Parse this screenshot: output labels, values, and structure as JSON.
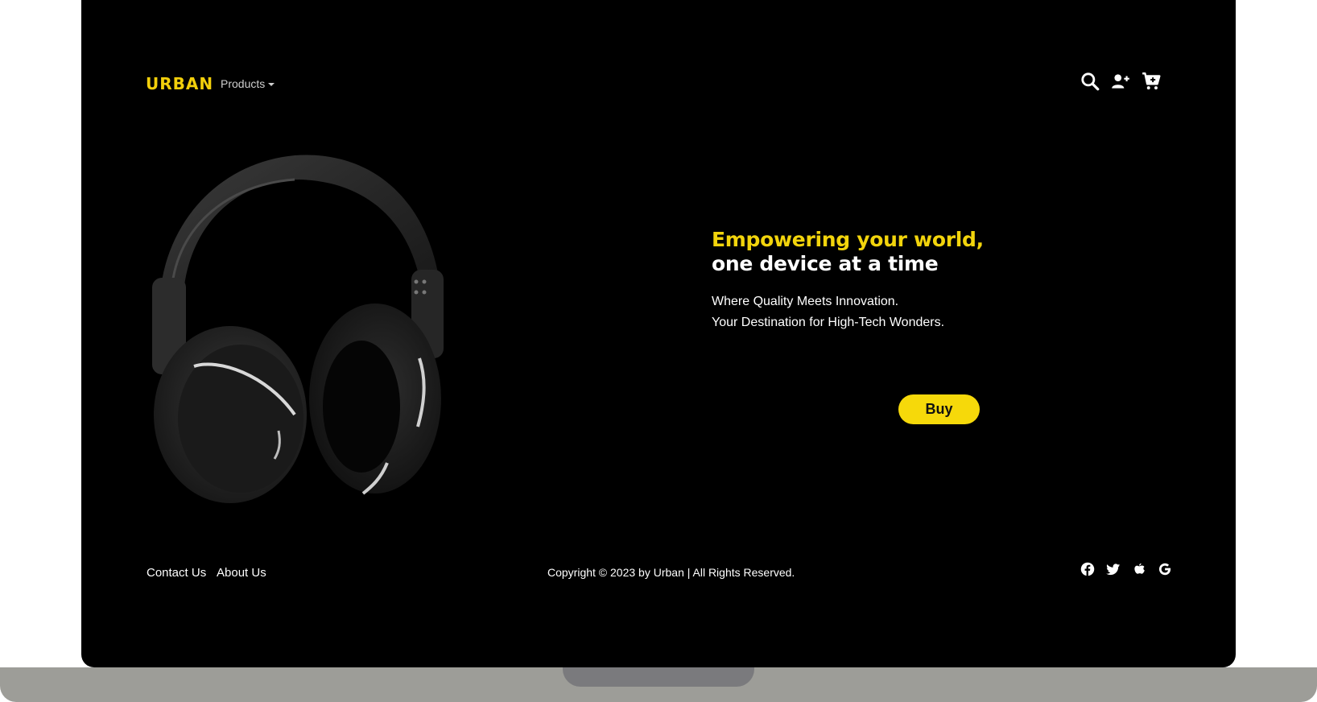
{
  "brand": {
    "logo_text": "URBAN",
    "accent_color": "#f2d40c"
  },
  "nav": {
    "products_label": "Products",
    "icons": [
      "search-icon",
      "add-user-icon",
      "cart-icon"
    ]
  },
  "hero": {
    "headline_accent": "Empowering your world,",
    "headline_rest": " one device at a time",
    "line1": "Where Quality Meets Innovation.",
    "line2": "Your Destination for High-Tech Wonders.",
    "buy_label": "Buy",
    "image": "headphones-image"
  },
  "footer": {
    "contact_label": "Contact Us",
    "about_label": "About Us",
    "copyright": "Copyright © 2023 by Urban | All Rights Reserved.",
    "social_icons": [
      "facebook-icon",
      "twitter-icon",
      "apple-icon",
      "google-icon"
    ]
  }
}
